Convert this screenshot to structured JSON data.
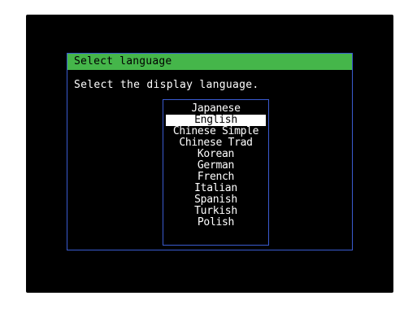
{
  "dialog": {
    "title": "Select language",
    "instruction": "Select the display language."
  },
  "languages": {
    "selected_index": 1,
    "items": [
      "Japanese",
      "English",
      "Chinese Simple",
      "Chinese Trad",
      "Korean",
      "German",
      "French",
      "Italian",
      "Spanish",
      "Turkish",
      "Polish"
    ]
  },
  "colors": {
    "title_bar": "#45b64a",
    "border": "#3a5bd0",
    "background": "#000000",
    "text": "#ffffff",
    "selection_bg": "#ffffff",
    "selection_text": "#000000"
  }
}
